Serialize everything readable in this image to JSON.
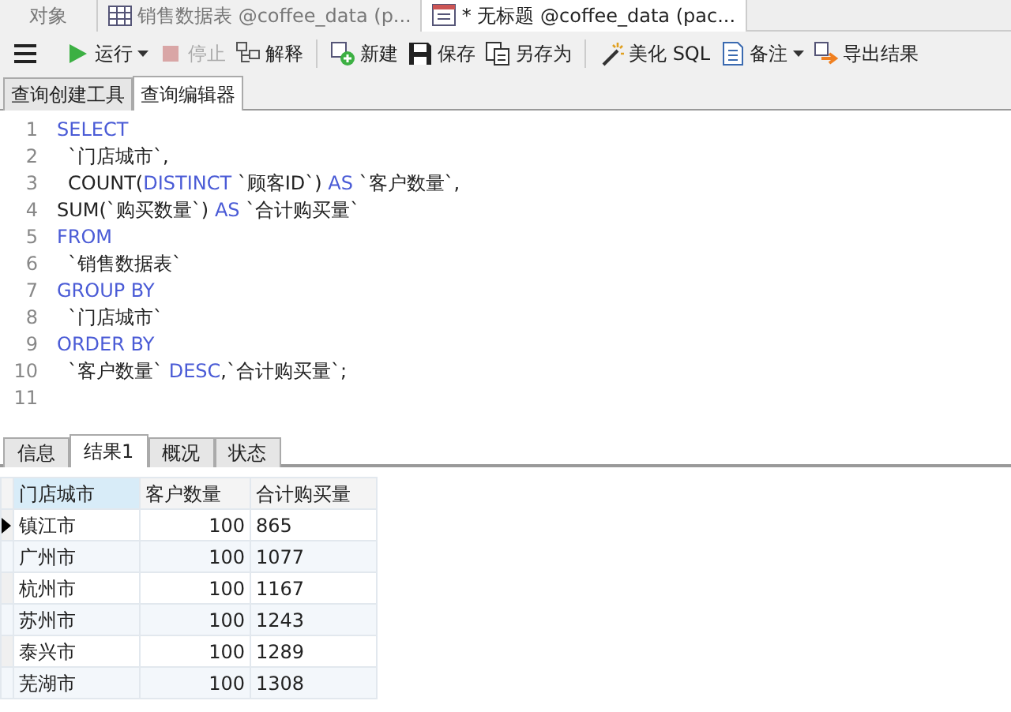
{
  "doc_tabs": [
    {
      "label": "对象",
      "selected": false
    },
    {
      "label": "销售数据表 @coffee_data (p...",
      "selected": false
    },
    {
      "label": "* 无标题 @coffee_data (pac...",
      "selected": true
    }
  ],
  "toolbar": {
    "groups": [
      [
        {
          "label": "运行",
          "dropdown": true,
          "disabled": false
        },
        {
          "label": "停止",
          "dropdown": false,
          "disabled": true
        },
        {
          "label": "解释",
          "dropdown": false,
          "disabled": false
        }
      ],
      [
        {
          "label": "新建",
          "dropdown": false,
          "disabled": false
        },
        {
          "label": "保存",
          "dropdown": false,
          "disabled": false
        },
        {
          "label": "另存为",
          "dropdown": false,
          "disabled": false
        }
      ],
      [
        {
          "label": "美化 SQL",
          "dropdown": false,
          "disabled": false
        },
        {
          "label": "备注",
          "dropdown": true,
          "disabled": false
        },
        {
          "label": "导出结果",
          "dropdown": false,
          "disabled": false
        }
      ]
    ]
  },
  "editor_tabs": [
    {
      "label": "查询创建工具",
      "selected": false
    },
    {
      "label": "查询编辑器",
      "selected": true
    }
  ],
  "editor": {
    "lines": [
      {
        "number": "1",
        "indent": false,
        "tokens": [
          {
            "text": "SELECT",
            "kind": "keyword"
          }
        ]
      },
      {
        "number": "2",
        "indent": true,
        "tokens": [
          {
            "text": "`门店城市`,",
            "kind": "plain"
          }
        ]
      },
      {
        "number": "3",
        "indent": true,
        "tokens": [
          {
            "text": "COUNT(",
            "kind": "plain"
          },
          {
            "text": "DISTINCT",
            "kind": "keyword"
          },
          {
            "text": " `顾客ID`) ",
            "kind": "plain"
          },
          {
            "text": "AS",
            "kind": "keyword"
          },
          {
            "text": " `客户数量`,",
            "kind": "plain"
          }
        ]
      },
      {
        "number": "4",
        "indent": false,
        "tokens": [
          {
            "text": "SUM(`购买数量`) ",
            "kind": "plain"
          },
          {
            "text": "AS",
            "kind": "keyword"
          },
          {
            "text": " `合计购买量`",
            "kind": "plain"
          }
        ]
      },
      {
        "number": "5",
        "indent": false,
        "tokens": [
          {
            "text": "FROM",
            "kind": "keyword"
          }
        ]
      },
      {
        "number": "6",
        "indent": true,
        "tokens": [
          {
            "text": "`销售数据表`",
            "kind": "plain"
          }
        ]
      },
      {
        "number": "7",
        "indent": false,
        "tokens": [
          {
            "text": "GROUP BY",
            "kind": "keyword"
          }
        ]
      },
      {
        "number": "8",
        "indent": true,
        "tokens": [
          {
            "text": "`门店城市`",
            "kind": "plain"
          }
        ]
      },
      {
        "number": "9",
        "indent": false,
        "tokens": [
          {
            "text": "ORDER BY",
            "kind": "keyword"
          }
        ]
      },
      {
        "number": "10",
        "indent": true,
        "tokens": [
          {
            "text": "`客户数量` ",
            "kind": "plain"
          },
          {
            "text": "DESC",
            "kind": "keyword"
          },
          {
            "text": ",`合计购买量`;",
            "kind": "plain"
          }
        ]
      },
      {
        "number": "11"
      }
    ]
  },
  "result_tabs": [
    {
      "label": "信息",
      "selected": false
    },
    {
      "label": "结果1",
      "selected": true
    },
    {
      "label": "概况",
      "selected": false
    },
    {
      "label": "状态",
      "selected": false
    }
  ],
  "table": {
    "columns": [
      "门店城市",
      "客户数量",
      "合计购买量"
    ],
    "rows": [
      {
        "cells": [
          "镇江市",
          "100",
          "865"
        ],
        "selected": true
      },
      {
        "cells": [
          "广州市",
          "100",
          "1077"
        ],
        "selected": false
      },
      {
        "cells": [
          "杭州市",
          "100",
          "1167"
        ],
        "selected": false
      },
      {
        "cells": [
          "苏州市",
          "100",
          "1243"
        ],
        "selected": false
      },
      {
        "cells": [
          "泰兴市",
          "100",
          "1289"
        ],
        "selected": false
      },
      {
        "cells": [
          "芜湖市",
          "100",
          "1308"
        ],
        "selected": false
      }
    ]
  }
}
